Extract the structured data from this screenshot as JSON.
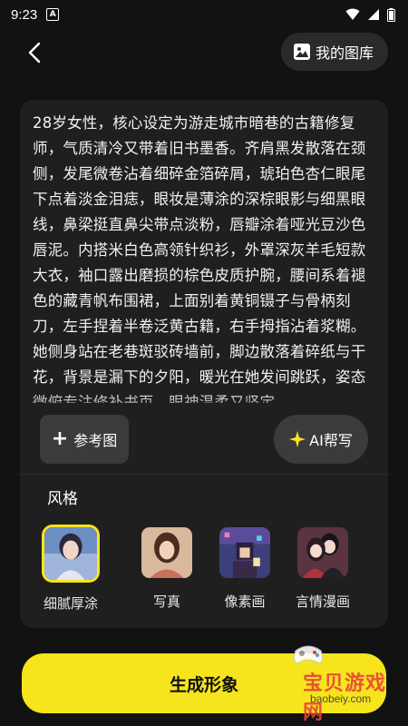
{
  "status_bar": {
    "time": "9:23",
    "app_icon_letter": "A",
    "icons": [
      "wifi-icon",
      "signal-icon",
      "battery-icon"
    ]
  },
  "header": {
    "back_icon": "chevron-left-icon",
    "gallery_label": "我的图库",
    "gallery_icon": "image-icon"
  },
  "prompt": {
    "text": "28岁女性，核心设定为游走城市暗巷的古籍修复师，气质清冷又带着旧书墨香。齐肩黑发散落在颈侧，发尾微卷沾着细碎金箔碎屑，琥珀色杏仁眼尾下点着淡金泪痣，眼妆是薄涂的深棕眼影与细黑眼线，鼻梁挺直鼻尖带点淡粉，唇瓣涂着哑光豆沙色唇泥。内搭米白色高领针织衫，外罩深灰羊毛短款大衣，袖口露出磨损的棕色皮质护腕，腰间系着褪色的藏青帆布围裙，上面别着黄铜镊子与骨柄刻刀，左手捏着半卷泛黄古籍，右手拇指沾着浆糊。她侧身站在老巷斑驳砖墙前，脚边散落着碎纸与干花，背景是漏下的夕阳，暖光在她发间跳跃，姿态微俯专注修补书页，眼神温柔又坚定。"
  },
  "actions": {
    "reference_label": "参考图",
    "ai_help_label": "AI帮写",
    "ai_help_icon": "sparkle-icon"
  },
  "styles": {
    "title": "风格",
    "items": [
      {
        "label": "细腻厚涂",
        "selected": true
      },
      {
        "label": "写真",
        "selected": false
      },
      {
        "label": "像素画",
        "selected": false
      },
      {
        "label": "言情漫画",
        "selected": false
      }
    ]
  },
  "generate": {
    "label": "生成形象"
  },
  "watermark": {
    "text": "宝贝游戏网",
    "url": "baobeiy.com"
  },
  "colors": {
    "accent": "#f6e51c",
    "background": "#121212",
    "card": "#1f1f1f",
    "button": "#3b3b3b"
  }
}
